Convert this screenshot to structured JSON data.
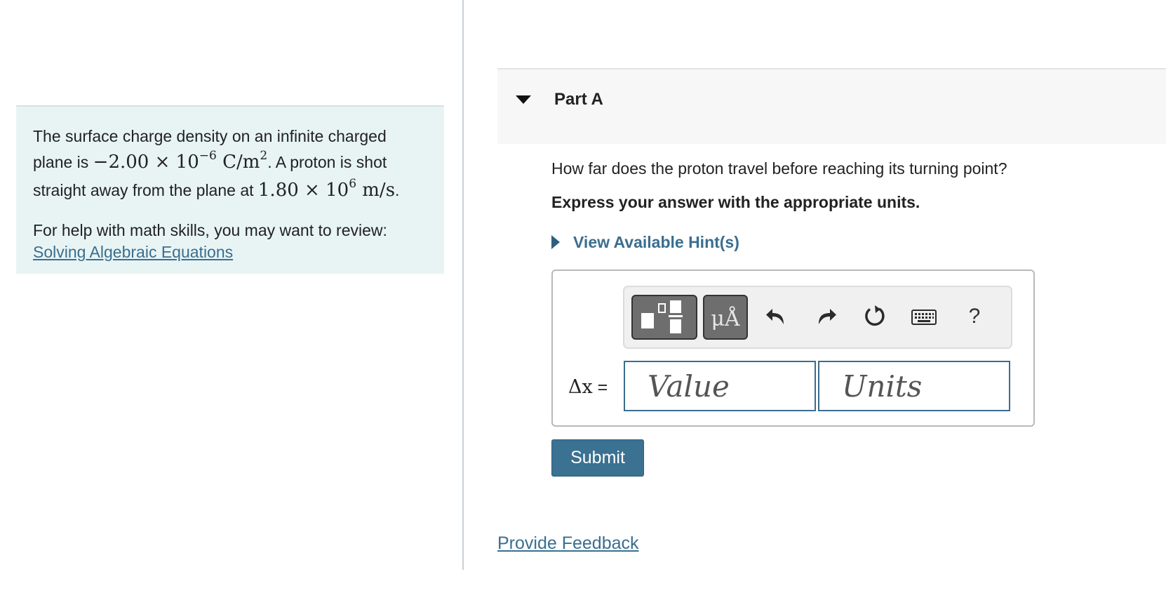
{
  "problem": {
    "text_pre": "The surface charge density on an infinite charged plane is ",
    "density_math": "−2.00 × 10",
    "density_exp": "−6",
    "density_unit": " C/m",
    "density_unit_exp": "2",
    "text_mid": ". A proton is shot straight away from the plane at ",
    "speed_math": "1.80 × 10",
    "speed_exp": "6",
    "speed_unit": " m/s",
    "text_end": ".",
    "help_text": "For help with math skills, you may want to review:",
    "help_link": "Solving Algebraic Equations"
  },
  "part": {
    "title": "Part A",
    "question": "How far does the proton travel before reaching its turning point?",
    "instructions": "Express your answer with the appropriate units.",
    "hint_label": "View Available Hint(s)"
  },
  "toolbar": {
    "symbols_label": "μÅ",
    "help_label": "?"
  },
  "answer": {
    "variable": "Δx",
    "equals": " =",
    "value_placeholder": "Value",
    "units_placeholder": "Units"
  },
  "actions": {
    "submit_label": "Submit",
    "feedback_label": "Provide Feedback"
  },
  "colors": {
    "accent": "#3b7191",
    "link": "#3a6e8f",
    "panel_bg": "#e8f4f4"
  },
  "icons": [
    "templates-icon",
    "symbols-icon",
    "undo-icon",
    "redo-icon",
    "reset-icon",
    "keyboard-icon",
    "help-icon",
    "collapse-triangle-icon",
    "expand-triangle-icon"
  ]
}
